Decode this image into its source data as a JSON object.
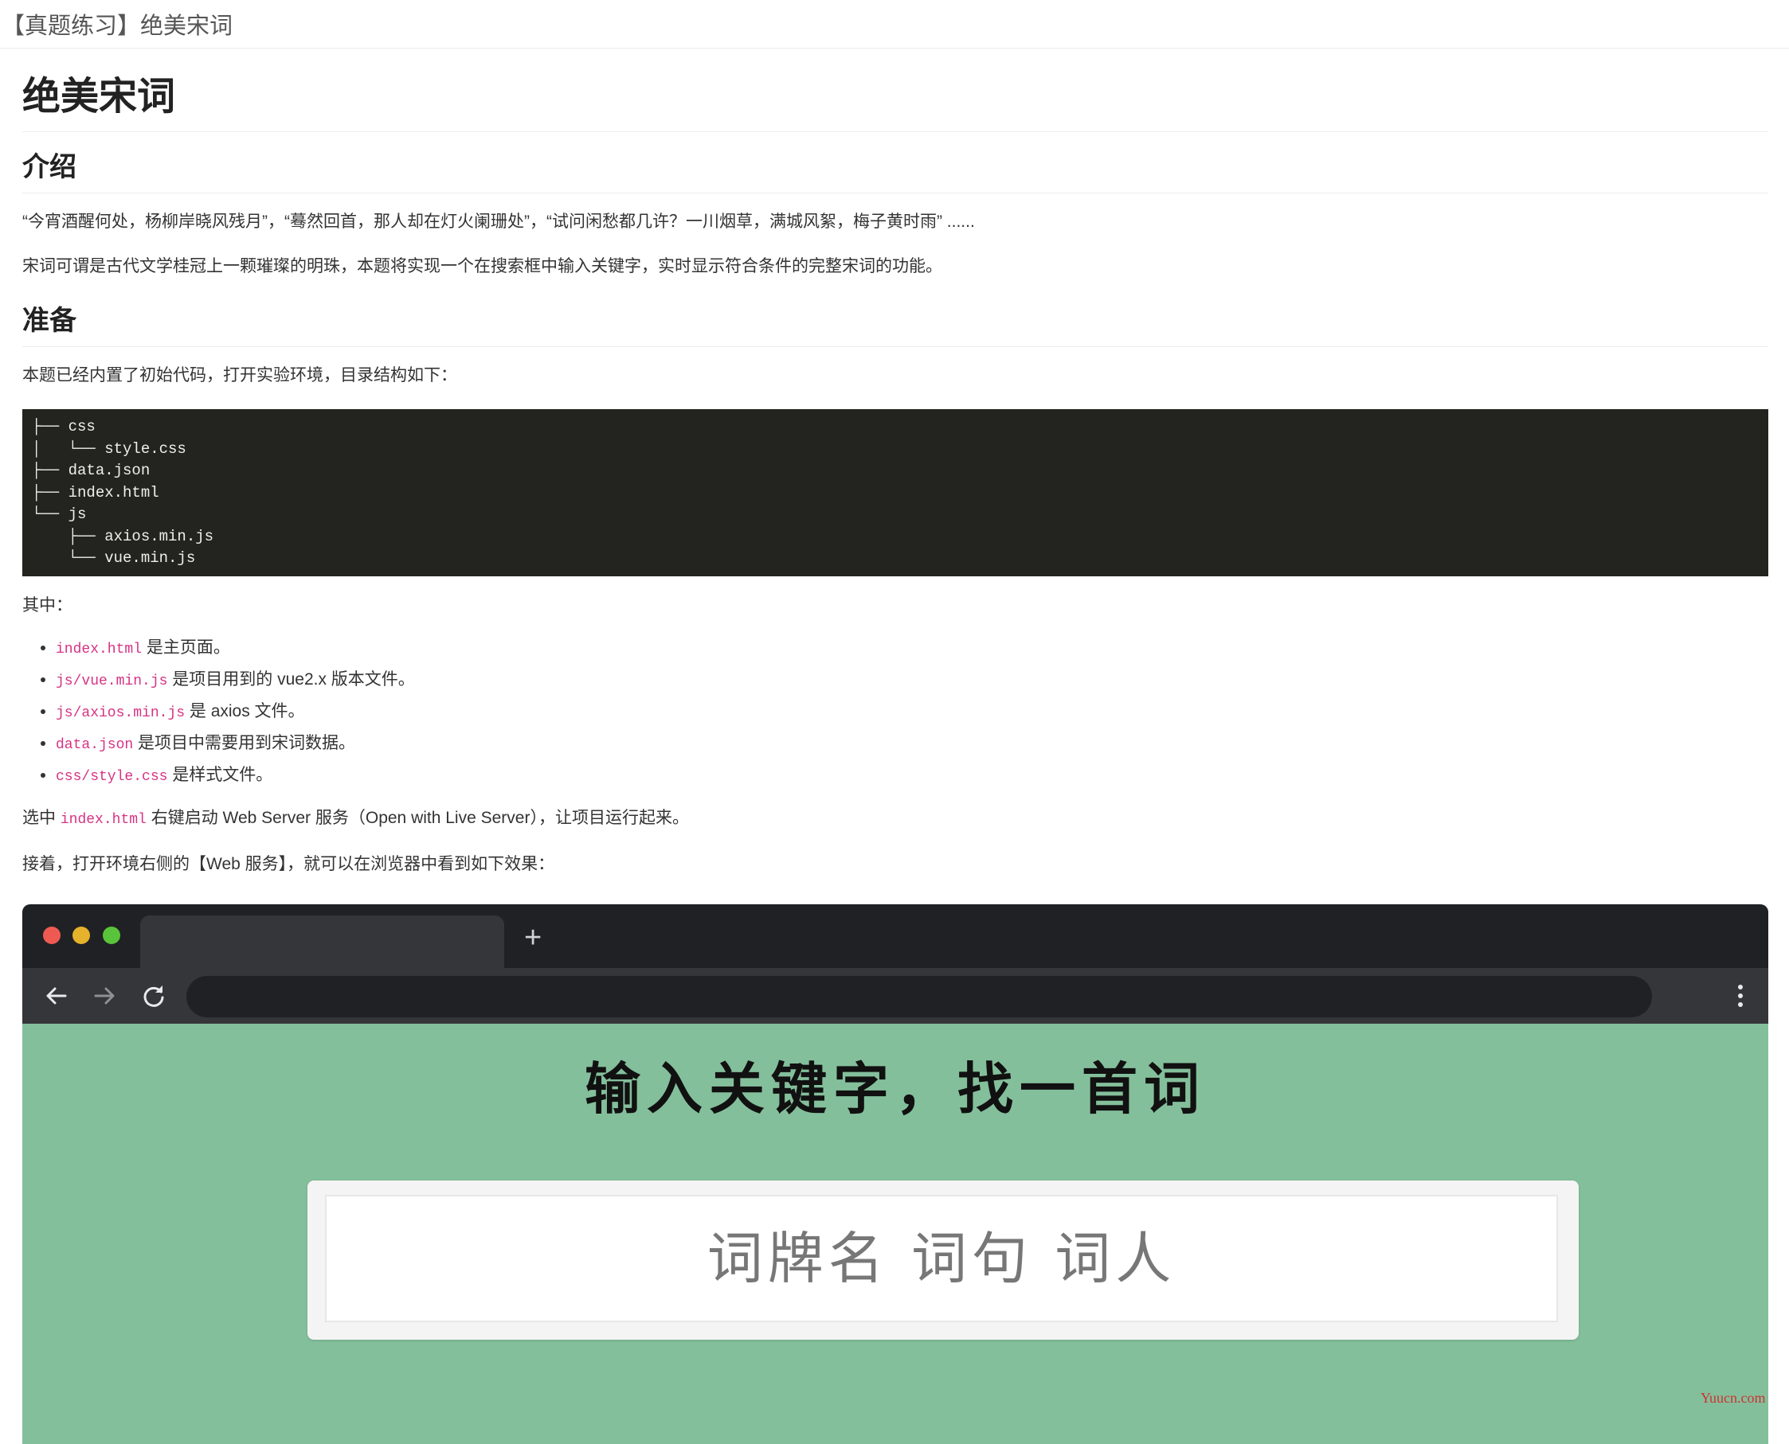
{
  "header": {
    "title": "【真题练习】绝美宋词"
  },
  "article": {
    "title": "绝美宋词",
    "section_intro": {
      "heading": "介绍",
      "paragraph1": "“今宵酒醒何处，杨柳岸晓风残月”，“蓦然回首，那人却在灯火阑珊处”，“试问闲愁都几许？一川烟草，满城风絮，梅子黄时雨” ......",
      "paragraph2": "宋词可谓是古代文学桂冠上一颗璀璨的明珠，本题将实现一个在搜索框中输入关键字，实时显示符合条件的完整宋词的功能。"
    },
    "section_prep": {
      "heading": "准备",
      "paragraph1": "本题已经内置了初始代码，打开实验环境，目录结构如下：",
      "code_tree": [
        "├── css",
        "│   └── style.css",
        "├── data.json",
        "├── index.html",
        "└── js",
        "    ├── axios.min.js",
        "    └── vue.min.js"
      ],
      "among_label": "其中：",
      "files": [
        {
          "code": "index.html",
          "text": " 是主页面。"
        },
        {
          "code": "js/vue.min.js",
          "text": " 是项目用到的 vue2.x 版本文件。"
        },
        {
          "code": "js/axios.min.js",
          "text": " 是 axios 文件。"
        },
        {
          "code": "data.json",
          "text": " 是项目中需要用到宋词数据。"
        },
        {
          "code": "css/style.css",
          "text": " 是样式文件。"
        }
      ],
      "serve_prefix": "选中 ",
      "serve_code": "index.html",
      "serve_suffix": " 右键启动 Web Server 服务（Open with Live Server），让项目运行起来。",
      "then_text": "接着，打开环境右侧的【Web 服务】，就可以在浏览器中看到如下效果："
    }
  },
  "browser": {
    "tab_add_icon": "plus-icon",
    "address_value": "",
    "app_title": "输入关键字，找一首词",
    "search_placeholder": "词牌名 词句 词人",
    "colors": {
      "page_bg": "#84bf9b",
      "dot_red": "#ee5a52",
      "dot_yellow": "#e6b12b",
      "dot_green": "#59c43b"
    }
  },
  "watermark": "Yuucn.com"
}
